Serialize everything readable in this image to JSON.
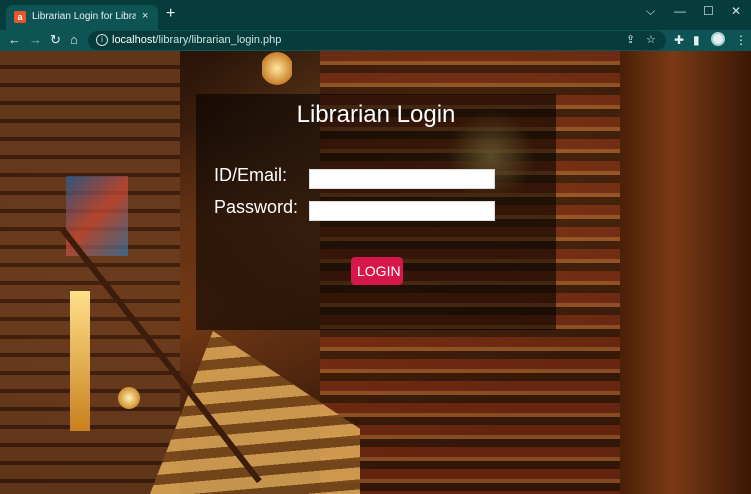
{
  "browser": {
    "tab_title": "Librarian Login for Library Manag",
    "favicon_letter": "a",
    "tab_close": "×",
    "new_tab": "+",
    "window_controls": {
      "dropdown": "⌵",
      "minimize": "—",
      "maximize": "☐",
      "close": "✕"
    },
    "nav": {
      "back": "←",
      "forward": "→",
      "reload": "↻",
      "home": "⌂"
    },
    "url_host": "localhost",
    "url_path": "/library/librarian_login.php",
    "omnibox_icons": {
      "share": "⇪",
      "bookmark": "☆"
    },
    "toolbar_icons": {
      "extensions": "✚",
      "sidepanel": "▮",
      "menu": "⋮"
    }
  },
  "login": {
    "title": "Librarian Login",
    "id_label": "ID/Email:",
    "id_value": "",
    "password_label": "Password:",
    "password_value": "",
    "button_label": "LOGIN"
  },
  "colors": {
    "tabbar": "#063c3c",
    "toolbar": "#0f5455",
    "login_button": "#d6174a",
    "login_panel": "rgba(0,0,0,0.55)"
  }
}
